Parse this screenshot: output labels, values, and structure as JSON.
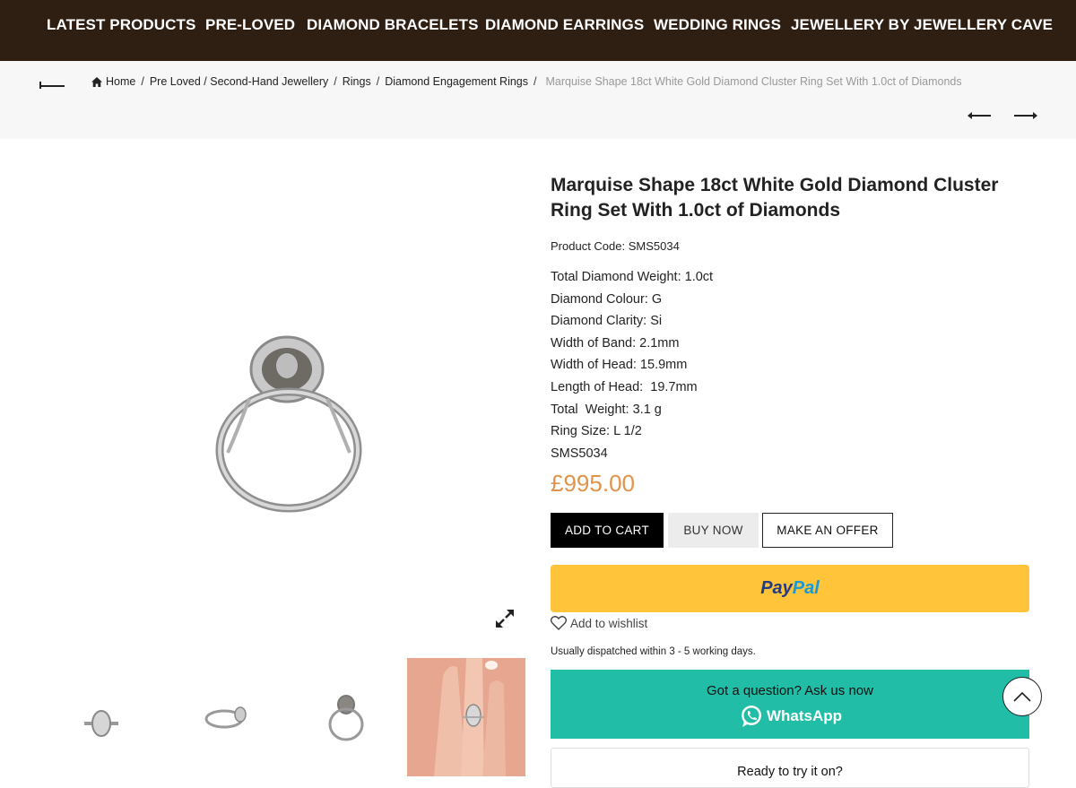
{
  "nav": {
    "items": [
      "LATEST PRODUCTS",
      "PRE-LOVED",
      "DIAMOND BRACELETS",
      "DIAMOND EARRINGS",
      "WEDDING RINGS",
      "JEWELLERY BY JEWELLERY CAVE"
    ],
    "background": "#2f1e12"
  },
  "breadcrumb": {
    "home": "Home",
    "items": [
      "Pre Loved / Second-Hand Jewellery",
      "Rings",
      "Diamond Engagement Rings"
    ],
    "current": "Marquise Shape 18ct White Gold Diamond Cluster Ring Set With 1.0ct of Diamonds",
    "icons": {
      "back": "long-left-arrow-icon",
      "home": "home-icon",
      "prev": "left-arrow-icon",
      "next": "right-arrow-icon"
    }
  },
  "product": {
    "title": "Marquise Shape 18ct White Gold Diamond Cluster Ring Set With 1.0ct of Diamonds",
    "code": "Product Code: SMS5034",
    "specs": [
      "Total Diamond Weight: 1.0ct",
      "Diamond Colour: G",
      "Diamond Clarity: Si",
      "Width of Band: 2.1mm",
      "Width of Head: 15.9mm",
      "Length of Head:  19.7mm",
      "Total  Weight: 3.1 g",
      "Ring Size: L 1/2",
      "SMS5034"
    ],
    "price": "£995.00",
    "price_color": "#e0944b"
  },
  "buttons": {
    "add_to_cart": "ADD TO CART",
    "buy_now": "BUY NOW",
    "make_offer": "MAKE AN OFFER"
  },
  "paypal": {
    "part1": "Pay",
    "part2": "Pal",
    "color": "#ffc439"
  },
  "wishlist": {
    "label": "Add to wishlist",
    "icon": "heart-icon"
  },
  "dispatch": "Usually dispatched within 3 - 5 working days.",
  "whatsapp": {
    "question": "Got a question? Ask us now",
    "label": "WhatsApp",
    "color": "#21bda6"
  },
  "tryon": {
    "label": "Ready to try it on?"
  },
  "gallery": {
    "main_image": "ring-main-image",
    "expand_icon": "expand-icon",
    "thumbs": [
      "ring-top-view",
      "ring-side-view",
      "ring-front-view",
      "ring-on-hand"
    ]
  },
  "scroll_top_icon": "chevron-up-icon"
}
